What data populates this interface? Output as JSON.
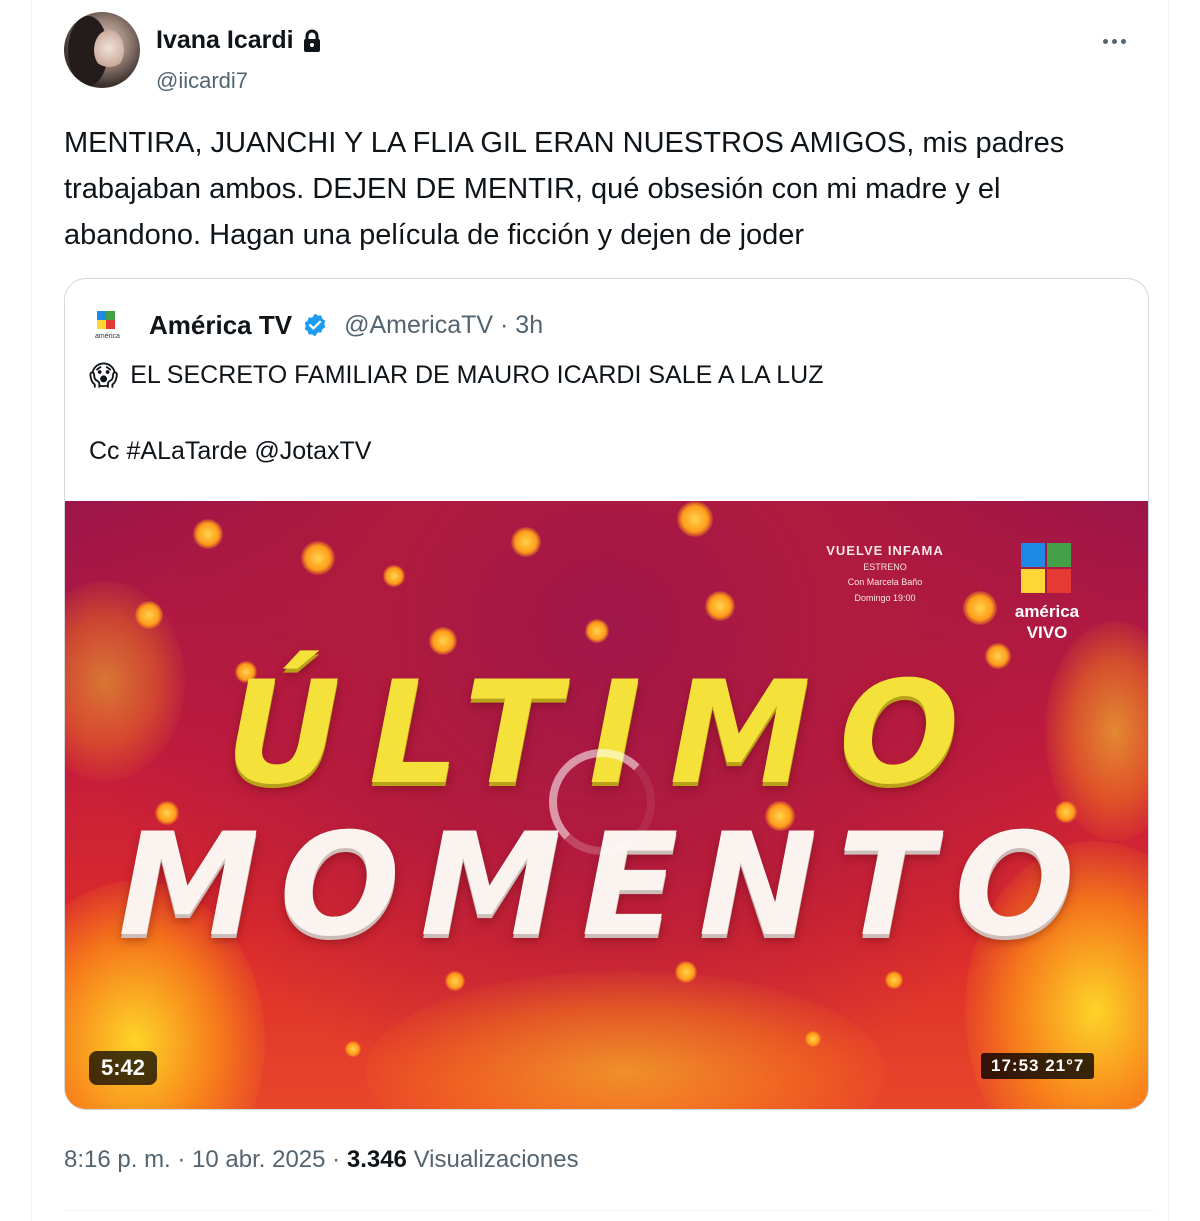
{
  "author": {
    "name": "Ivana Icardi",
    "handle": "@iicardi7",
    "avatar_icon": "avatar-photo",
    "protected_icon": "lock-icon"
  },
  "more_icon": "more-horizontal-icon",
  "tweet": {
    "text": "MENTIRA, JUANCHI Y LA FLIA GIL ERAN NUESTROS AMIGOS, mis padres trabajaban ambos. DEJEN DE MENTIR, qué obsesión con mi madre y el abandono. Hagan una película de ficción y dejen de joder"
  },
  "quote": {
    "name": "América TV",
    "verified_icon": "verified-badge-icon",
    "handle_time": "@AmericaTV · 3h",
    "emoji": "😱",
    "line1": "EL SECRETO FAMILIAR DE MAURO ICARDI SALE A LA LUZ",
    "line2": "Cc #ALaTarde @JotaxTV",
    "logo_small_label": "américa",
    "video": {
      "headline_top": "ÚLTIMO",
      "headline_bottom": "MOMENTO",
      "promo_title": "VUELVE INFAMA",
      "promo_sub": "ESTRENO",
      "promo_line1": "Con Marcela Baño",
      "promo_line2": "Domingo 19:00",
      "brand_line1": "américa",
      "brand_line2": "VIVO",
      "duration": "5:42",
      "clock": "17:53  21°7"
    }
  },
  "meta": {
    "time_date": "8:16 p. m. · 10 abr. 2025 · ",
    "views_count": "3.346",
    "views_label": " Visualizaciones"
  },
  "colors": {
    "text": "#0f1419",
    "secondary": "#536471",
    "verified": "#1d9bf0",
    "logo_blue": "#1e88e5",
    "logo_green": "#43a047",
    "logo_yellow": "#fdd835",
    "logo_red": "#e53935"
  }
}
